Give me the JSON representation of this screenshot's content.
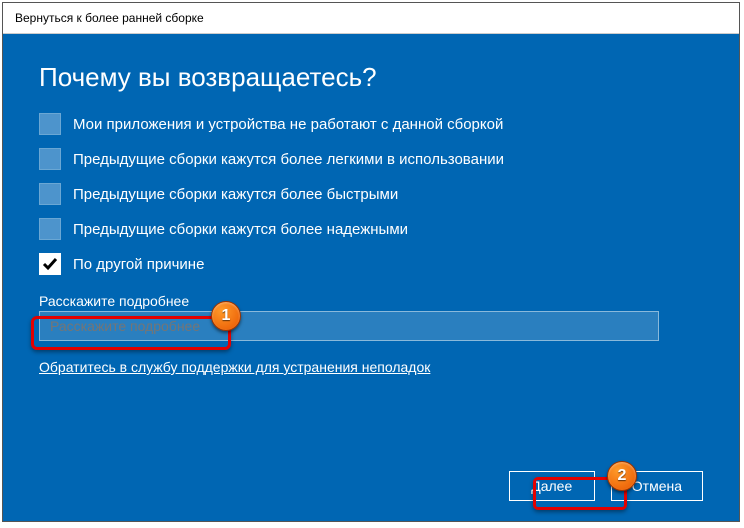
{
  "window": {
    "title": "Вернуться к более ранней сборке"
  },
  "heading": "Почему вы возвращаетесь?",
  "options": [
    {
      "label": "Мои приложения и устройства не работают с данной сборкой",
      "checked": false
    },
    {
      "label": "Предыдущие сборки кажутся более легкими в использовании",
      "checked": false
    },
    {
      "label": "Предыдущие сборки кажутся более быстрыми",
      "checked": false
    },
    {
      "label": "Предыдущие сборки кажутся более надежными",
      "checked": false
    },
    {
      "label": "По другой причине",
      "checked": true
    }
  ],
  "details": {
    "label": "Расскажите подробнее",
    "placeholder": "Расскажите подробнее"
  },
  "support_link": "Обратитесь в службу поддержки для устранения неполадок",
  "buttons": {
    "next": "Далее",
    "cancel": "Отмена"
  },
  "annotations": {
    "badge1": "1",
    "badge2": "2"
  }
}
